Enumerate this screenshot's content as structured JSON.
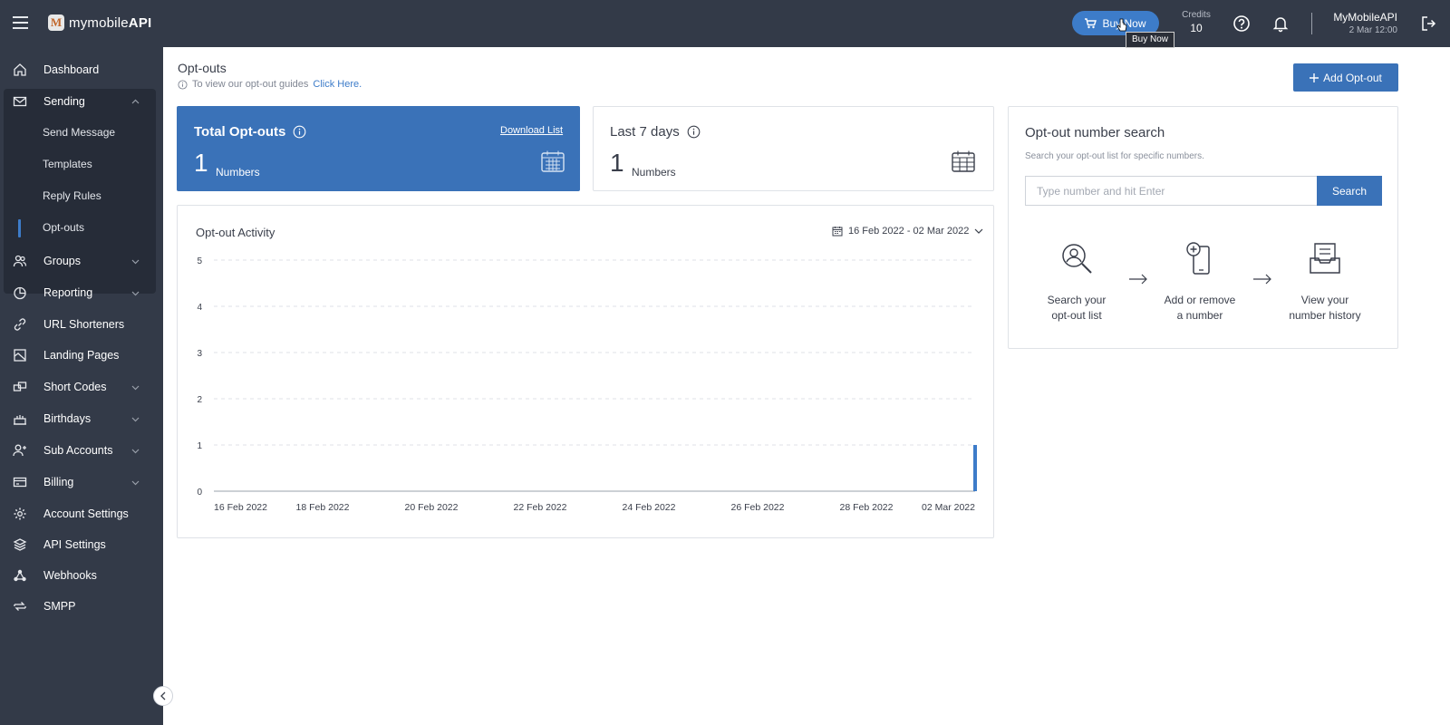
{
  "app": {
    "logo_prefix": "mymobile",
    "logo_suffix": "API",
    "logo_mark": "M"
  },
  "topbar": {
    "buy_label": "Buy Now",
    "tooltip": "Buy Now",
    "credits_label": "Credits",
    "credits_value": "10",
    "user_name": "MyMobileAPI",
    "user_time": "2 Mar 12:00"
  },
  "sidebar": {
    "items": [
      {
        "label": "Dashboard",
        "icon": "home-icon"
      },
      {
        "label": "Sending",
        "icon": "envelope-icon",
        "expanded": true
      },
      {
        "label": "Groups",
        "icon": "users-icon"
      },
      {
        "label": "Reporting",
        "icon": "pie-chart-icon"
      },
      {
        "label": "URL Shorteners",
        "icon": "link-icon"
      },
      {
        "label": "Landing Pages",
        "icon": "landing-page-icon"
      },
      {
        "label": "Short Codes",
        "icon": "short-code-icon"
      },
      {
        "label": "Birthdays",
        "icon": "cake-icon"
      },
      {
        "label": "Sub Accounts",
        "icon": "add-user-icon"
      },
      {
        "label": "Billing",
        "icon": "credit-card-icon"
      },
      {
        "label": "Account Settings",
        "icon": "gear-icon"
      },
      {
        "label": "API Settings",
        "icon": "layers-icon"
      },
      {
        "label": "Webhooks",
        "icon": "webhook-icon"
      },
      {
        "label": "SMPP",
        "icon": "sync-icon"
      }
    ],
    "sending_sub": [
      "Send Message",
      "Templates",
      "Reply Rules",
      "Opt-outs"
    ],
    "active_sub": "Opt-outs"
  },
  "page": {
    "title": "Opt-outs",
    "guide_text": "To view our opt-out guides",
    "guide_link": "Click Here.",
    "add_button": "Add Opt-out"
  },
  "total": {
    "title": "Total Opt-outs",
    "download": "Download List",
    "value": "1",
    "unit": "Numbers"
  },
  "last7": {
    "title": "Last 7 days",
    "value": "1",
    "unit": "Numbers"
  },
  "search": {
    "title": "Opt-out number search",
    "subtitle": "Search your opt-out list for specific numbers.",
    "placeholder": "Type number and hit Enter",
    "button": "Search",
    "steps": [
      {
        "line1": "Search your",
        "line2": "opt-out list"
      },
      {
        "line1": "Add or remove",
        "line2": "a number"
      },
      {
        "line1": "View your",
        "line2": "number history"
      }
    ]
  },
  "activity": {
    "title": "Opt-out Activity",
    "date_range": "16 Feb 2022 - 02 Mar 2022"
  },
  "colors": {
    "primary": "#3a72b8",
    "sidebar": "#333a48",
    "bar": "#3d7cc9"
  },
  "chart_data": {
    "type": "bar",
    "title": "Opt-out Activity",
    "xlabel": "",
    "ylabel": "",
    "ylim": [
      0,
      5
    ],
    "yticks": [
      0,
      1,
      2,
      3,
      4,
      5
    ],
    "x_tick_labels": [
      "16 Feb 2022",
      "18 Feb 2022",
      "20 Feb 2022",
      "22 Feb 2022",
      "24 Feb 2022",
      "26 Feb 2022",
      "28 Feb 2022",
      "02 Mar 2022"
    ],
    "categories": [
      "2022-02-16",
      "2022-02-17",
      "2022-02-18",
      "2022-02-19",
      "2022-02-20",
      "2022-02-21",
      "2022-02-22",
      "2022-02-23",
      "2022-02-24",
      "2022-02-25",
      "2022-02-26",
      "2022-02-27",
      "2022-02-28",
      "2022-03-01",
      "2022-03-02"
    ],
    "values": [
      0,
      0,
      0,
      0,
      0,
      0,
      0,
      0,
      0,
      0,
      0,
      0,
      0,
      0,
      1
    ],
    "grid": true
  }
}
